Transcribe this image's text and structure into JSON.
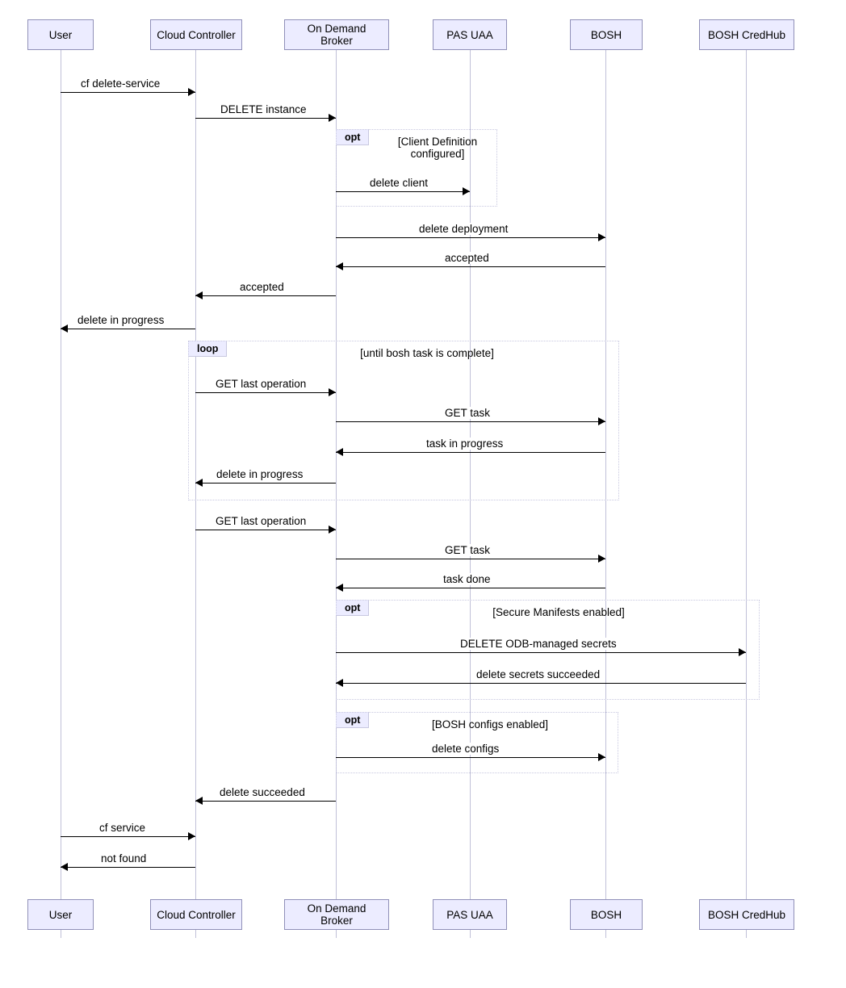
{
  "participants": [
    "User",
    "Cloud Controller",
    "On Demand Broker",
    "PAS UAA",
    "BOSH",
    "BOSH CredHub"
  ],
  "frags": {
    "opt1": {
      "tag": "opt",
      "guard": "[Client Definition\nconfigured]"
    },
    "loop": {
      "tag": "loop",
      "guard": "[until bosh task is complete]"
    },
    "opt2": {
      "tag": "opt",
      "guard": "[Secure Manifests enabled]"
    },
    "opt3": {
      "tag": "opt",
      "guard": "[BOSH configs enabled]"
    }
  },
  "msgs": {
    "m1": "cf delete-service",
    "m2": "DELETE instance",
    "m3": "delete client",
    "m4": "delete deployment",
    "m5": "accepted",
    "m6": "accepted",
    "m7": "delete in progress",
    "m8": "GET last operation",
    "m9": "GET task",
    "m10": "task in progress",
    "m11": "delete in progress",
    "m12": "GET last operation",
    "m13": "GET task",
    "m14": "task done",
    "m15": "DELETE ODB-managed secrets",
    "m16": "delete secrets succeeded",
    "m17": "delete configs",
    "m18": "delete succeeded",
    "m19": "cf service",
    "m20": "not found"
  },
  "chart_data": {
    "type": "sequence_diagram",
    "participants": [
      "User",
      "Cloud Controller",
      "On Demand Broker",
      "PAS UAA",
      "BOSH",
      "BOSH CredHub"
    ],
    "messages": [
      {
        "from": "User",
        "to": "Cloud Controller",
        "label": "cf delete-service"
      },
      {
        "from": "Cloud Controller",
        "to": "On Demand Broker",
        "label": "DELETE instance"
      },
      {
        "fragment": "opt",
        "guard": "Client Definition configured",
        "messages": [
          {
            "from": "On Demand Broker",
            "to": "PAS UAA",
            "label": "delete client"
          }
        ]
      },
      {
        "from": "On Demand Broker",
        "to": "BOSH",
        "label": "delete deployment"
      },
      {
        "from": "BOSH",
        "to": "On Demand Broker",
        "label": "accepted"
      },
      {
        "from": "On Demand Broker",
        "to": "Cloud Controller",
        "label": "accepted"
      },
      {
        "from": "Cloud Controller",
        "to": "User",
        "label": "delete in progress"
      },
      {
        "fragment": "loop",
        "guard": "until bosh task is complete",
        "messages": [
          {
            "from": "Cloud Controller",
            "to": "On Demand Broker",
            "label": "GET last operation"
          },
          {
            "from": "On Demand Broker",
            "to": "BOSH",
            "label": "GET task"
          },
          {
            "from": "BOSH",
            "to": "On Demand Broker",
            "label": "task in progress"
          },
          {
            "from": "On Demand Broker",
            "to": "Cloud Controller",
            "label": "delete in progress"
          }
        ]
      },
      {
        "from": "Cloud Controller",
        "to": "On Demand Broker",
        "label": "GET last operation"
      },
      {
        "from": "On Demand Broker",
        "to": "BOSH",
        "label": "GET task"
      },
      {
        "from": "BOSH",
        "to": "On Demand Broker",
        "label": "task done"
      },
      {
        "fragment": "opt",
        "guard": "Secure Manifests enabled",
        "messages": [
          {
            "from": "On Demand Broker",
            "to": "BOSH CredHub",
            "label": "DELETE ODB-managed secrets"
          },
          {
            "from": "BOSH CredHub",
            "to": "On Demand Broker",
            "label": "delete secrets succeeded"
          }
        ]
      },
      {
        "fragment": "opt",
        "guard": "BOSH configs enabled",
        "messages": [
          {
            "from": "On Demand Broker",
            "to": "BOSH",
            "label": "delete configs"
          }
        ]
      },
      {
        "from": "On Demand Broker",
        "to": "Cloud Controller",
        "label": "delete succeeded"
      },
      {
        "from": "User",
        "to": "Cloud Controller",
        "label": "cf service"
      },
      {
        "from": "Cloud Controller",
        "to": "User",
        "label": "not found"
      }
    ]
  }
}
